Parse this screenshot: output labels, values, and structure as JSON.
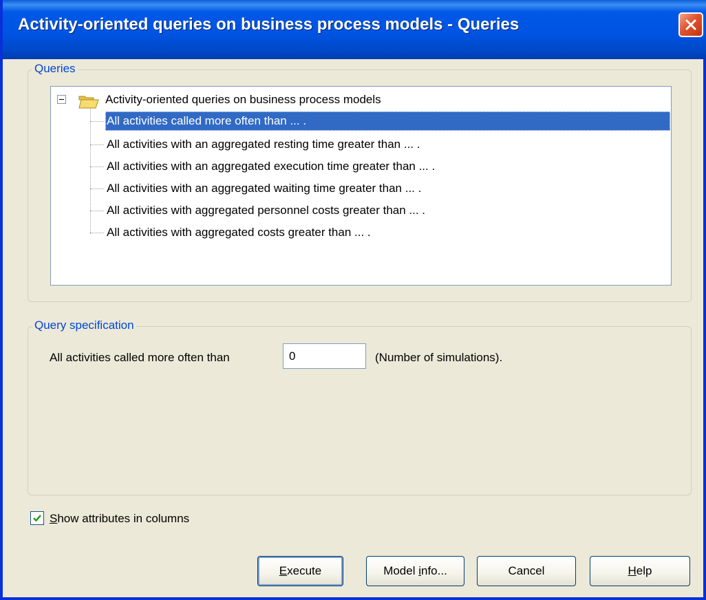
{
  "window": {
    "title": "Activity-oriented queries on business process models - Queries",
    "close_icon": "close-icon"
  },
  "queries_group": {
    "legend": "Queries",
    "tree": {
      "root": {
        "label": "Activity-oriented queries on business process models",
        "icon": "folder-open-icon",
        "expanded": true
      },
      "items": [
        {
          "label": "All activities called more often than ... .",
          "selected": true
        },
        {
          "label": "All activities with an aggregated resting time greater than ... .",
          "selected": false
        },
        {
          "label": "All activities with an aggregated execution time greater than ... .",
          "selected": false
        },
        {
          "label": "All activities with an aggregated waiting time greater than ... .",
          "selected": false
        },
        {
          "label": "All activities with aggregated personnel costs greater than ... .",
          "selected": false
        },
        {
          "label": "All activities with aggregated costs greater than ... .",
          "selected": false
        }
      ]
    }
  },
  "spec_group": {
    "legend": "Query specification",
    "prefix": "All activities called more often than",
    "value": "0",
    "suffix": "(Number of simulations)."
  },
  "options": {
    "show_attributes_label_mnemonic": "S",
    "show_attributes_label_rest": "how attributes in columns",
    "show_attributes_checked": true
  },
  "buttons": {
    "execute_mnemonic": "E",
    "execute_rest": "xecute",
    "model_info_pre": "Model ",
    "model_info_mnemonic": "i",
    "model_info_rest": "nfo...",
    "cancel": "Cancel",
    "help_mnemonic": "H",
    "help_rest": "elp"
  },
  "colors": {
    "title_bar": "#0054e3",
    "selection": "#316ac5",
    "group_legend": "#0046d5",
    "dialog_bg": "#ece9d8"
  }
}
